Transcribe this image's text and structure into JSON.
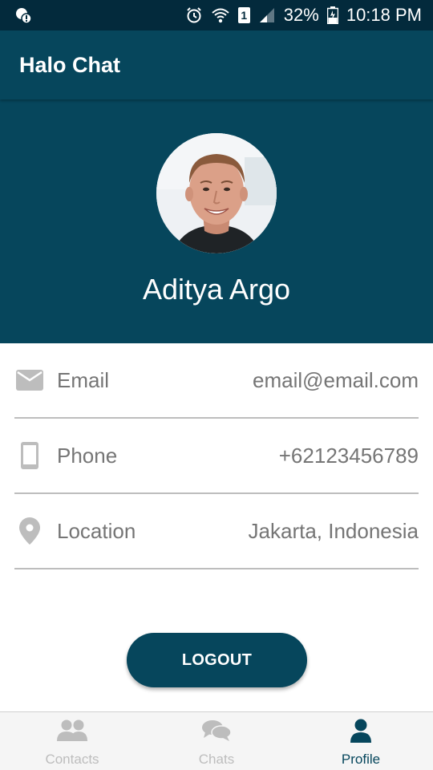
{
  "status_bar": {
    "battery": "32%",
    "time": "10:18 PM",
    "sim": "1"
  },
  "app_bar": {
    "title": "Halo Chat"
  },
  "profile": {
    "name": "Aditya Argo"
  },
  "info": [
    {
      "icon": "email-icon",
      "label": "Email",
      "value": "email@email.com"
    },
    {
      "icon": "phone-icon",
      "label": "Phone",
      "value": "+62123456789"
    },
    {
      "icon": "location-icon",
      "label": "Location",
      "value": "Jakarta, Indonesia"
    }
  ],
  "logout": {
    "label": "LOGOUT"
  },
  "bottom_nav": {
    "items": [
      {
        "icon": "contacts-icon",
        "label": "Contacts",
        "active": false
      },
      {
        "icon": "chats-icon",
        "label": "Chats",
        "active": false
      },
      {
        "icon": "profile-icon",
        "label": "Profile",
        "active": true
      }
    ]
  },
  "colors": {
    "primary": "#06465c",
    "status_bar": "#032a3c",
    "inactive": "#bdbdbd",
    "text_grey": "#757575"
  }
}
